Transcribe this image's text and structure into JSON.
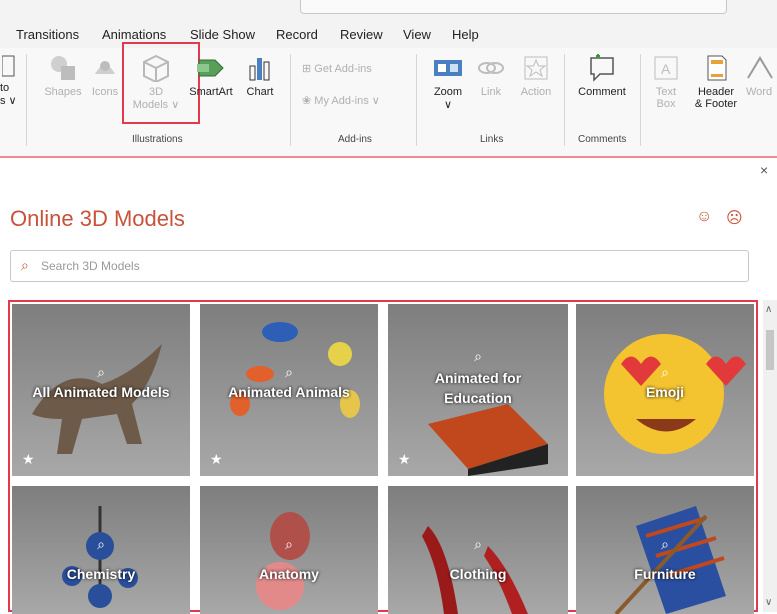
{
  "tabs": [
    "Transitions",
    "Animations",
    "Slide Show",
    "Record",
    "Review",
    "View",
    "Help"
  ],
  "ribbon": {
    "left_partial": {
      "line1": "to",
      "line2": "s ∨"
    },
    "illustrations": {
      "shapes": "Shapes",
      "icons": "Icons",
      "models_line1": "3D",
      "models_line2": "Models ∨",
      "smartart": "SmartArt",
      "chart": "Chart",
      "group": "Illustrations"
    },
    "addins": {
      "get": "Get Add-ins",
      "my": "My Add-ins",
      "group": "Add-ins"
    },
    "links": {
      "zoom": "Zoom",
      "zoom_arrow": "∨",
      "link": "Link",
      "action": "Action",
      "group": "Links"
    },
    "comments": {
      "comment": "Comment",
      "group": "Comments"
    },
    "text": {
      "textbox_line1": "Text",
      "textbox_line2": "Box",
      "header_line1": "Header",
      "header_line2": "& Footer",
      "wordart": "Word"
    }
  },
  "pane": {
    "close": "×",
    "title": "Online 3D Models",
    "search_placeholder": "Search 3D Models",
    "feedback_icons": [
      "☺",
      "☹"
    ],
    "categories": [
      {
        "label": "All Animated Models",
        "animated": true
      },
      {
        "label": "Animated Animals",
        "animated": true
      },
      {
        "label": "Animated for Education",
        "animated": true
      },
      {
        "label": "Emoji",
        "animated": false
      },
      {
        "label": "Chemistry",
        "animated": false
      },
      {
        "label": "Anatomy",
        "animated": false
      },
      {
        "label": "Clothing",
        "animated": false
      },
      {
        "label": "Furniture",
        "animated": false
      }
    ]
  },
  "colors": {
    "accent": "#c8523b",
    "highlight": "#e23a4d"
  }
}
